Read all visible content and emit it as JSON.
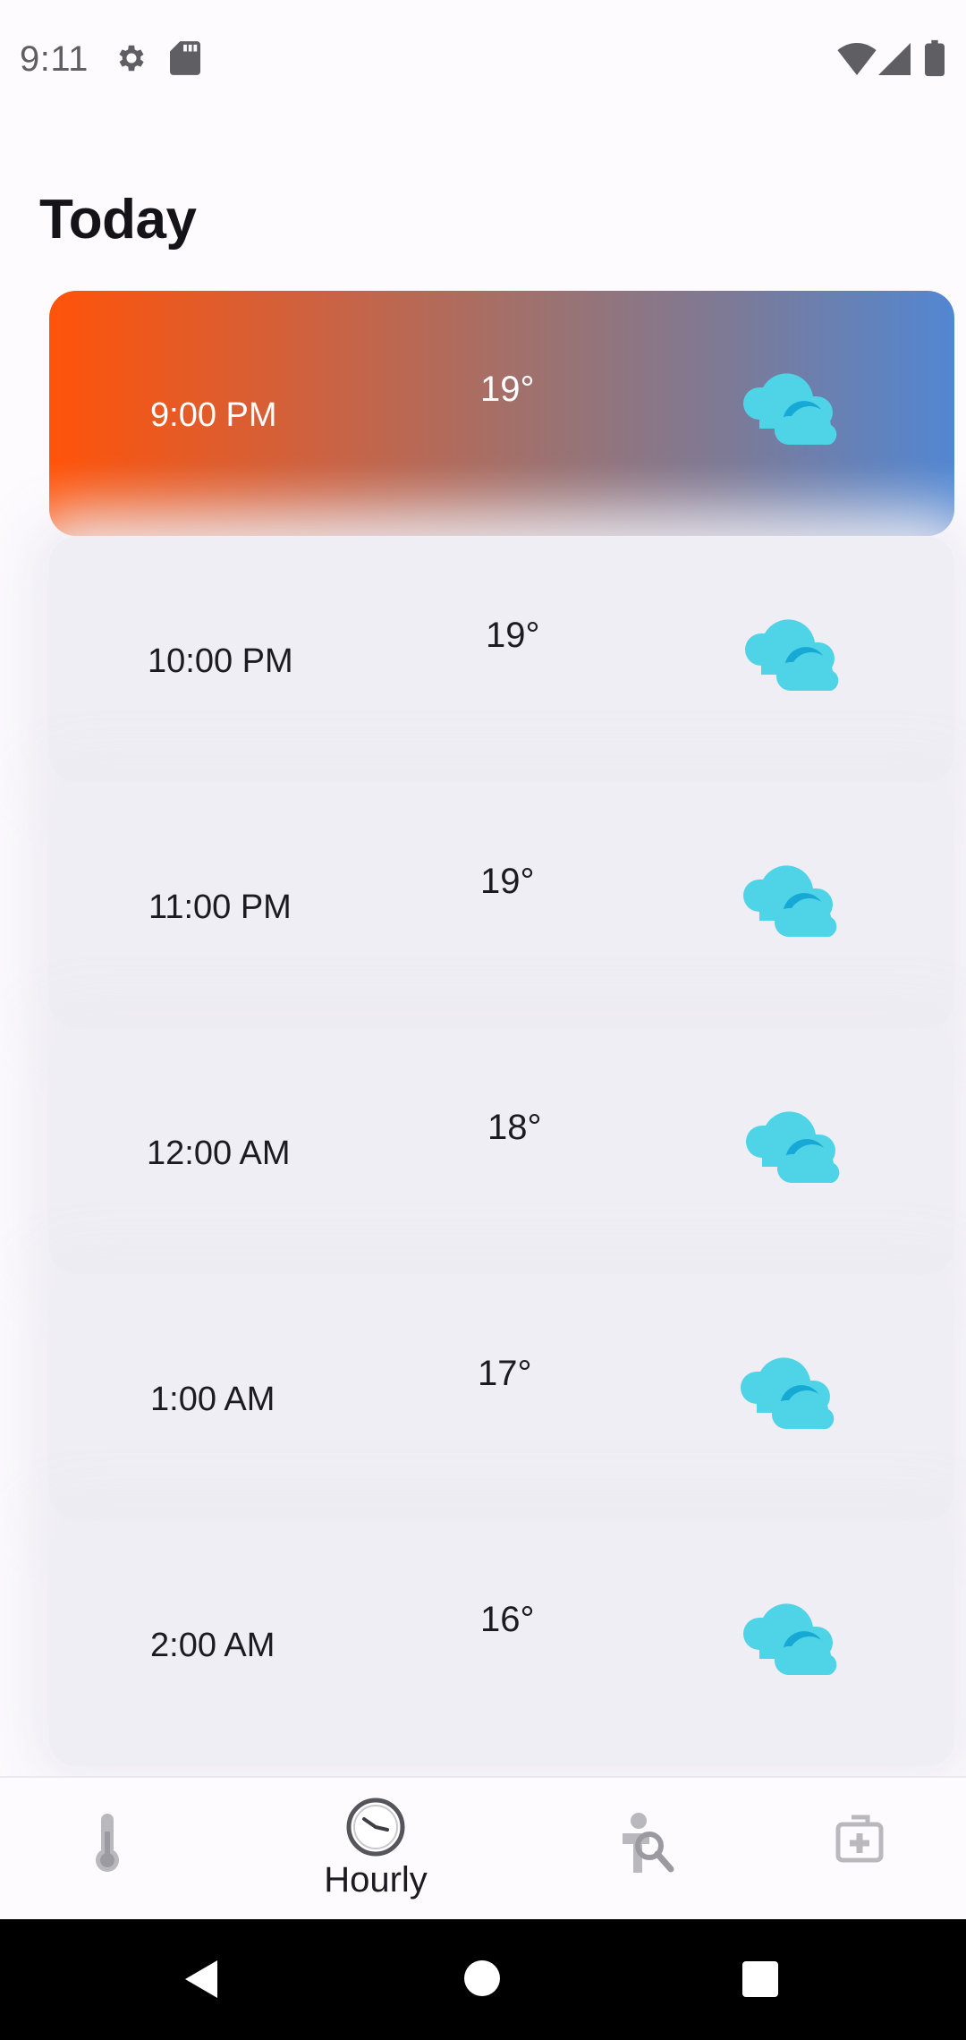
{
  "status_bar": {
    "time": "9:11",
    "icons": [
      "settings-icon",
      "sd-card-icon",
      "wifi-icon",
      "signal-icon",
      "battery-icon"
    ]
  },
  "page": {
    "title": "Today"
  },
  "hourly": [
    {
      "time": "9:00 PM",
      "temp": "19°",
      "icon": "partly-cloudy-icon",
      "selected": true
    },
    {
      "time": "10:00 PM",
      "temp": "19°",
      "icon": "partly-cloudy-icon",
      "selected": false
    },
    {
      "time": "11:00 PM",
      "temp": "19°",
      "icon": "partly-cloudy-icon",
      "selected": false
    },
    {
      "time": "12:00 AM",
      "temp": "18°",
      "icon": "partly-cloudy-icon",
      "selected": false
    },
    {
      "time": "1:00 AM",
      "temp": "17°",
      "icon": "partly-cloudy-icon",
      "selected": false
    },
    {
      "time": "2:00 AM",
      "temp": "16°",
      "icon": "partly-cloudy-icon",
      "selected": false
    }
  ],
  "bottom_nav": {
    "items": [
      {
        "icon": "thermometer-icon",
        "label": "",
        "active": false
      },
      {
        "icon": "clock-icon",
        "label": "Hourly",
        "active": true
      },
      {
        "icon": "person-search-icon",
        "label": "",
        "active": false
      },
      {
        "icon": "medical-kit-icon",
        "label": "",
        "active": false
      }
    ]
  },
  "colors": {
    "gradient_start": "#ff5309",
    "gradient_end": "#5287d2",
    "cloud_light": "#4fd3e6",
    "cloud_dark": "#16a9d6",
    "row_background": "#efeef4"
  }
}
